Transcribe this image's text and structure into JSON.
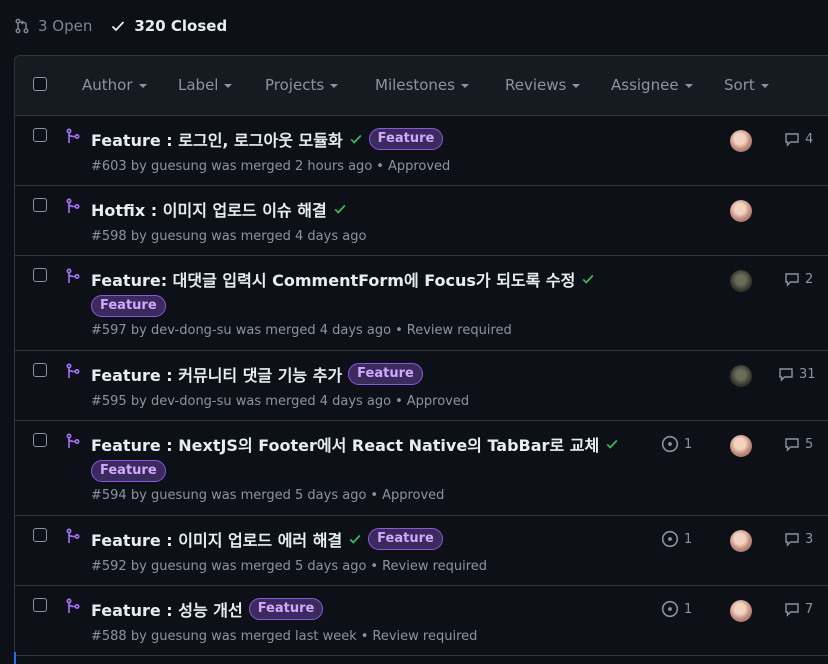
{
  "state": {
    "open_label": "3 Open",
    "closed_label": "320 Closed"
  },
  "filters": {
    "author": "Author",
    "label": "Label",
    "projects": "Projects",
    "milestones": "Milestones",
    "reviews": "Reviews",
    "assignee": "Assignee",
    "sort": "Sort"
  },
  "icons": {
    "pr_open": "git-pull-request-icon",
    "closed_check": "check-icon",
    "merged": "git-merge-icon",
    "status_success": "check-icon",
    "linked_issue": "issue-opened-icon",
    "comment": "comment-icon"
  },
  "colors": {
    "merged": "#a371f7",
    "success": "#3fb950",
    "label_text": "#d2a8ff"
  },
  "pull_requests": [
    {
      "title": "Feature : 로그인, 로그아웃 모듈화",
      "label": "Feature",
      "number": "#603",
      "by": "by",
      "author": "guesung",
      "merged_text": "was merged 2 hours ago",
      "review": "Approved",
      "issues": "",
      "comments": "4"
    },
    {
      "title": "Hotfix : 이미지 업로드 이슈 해결",
      "label": "",
      "number": "#598",
      "by": "by",
      "author": "guesung",
      "merged_text": "was merged 4 days ago",
      "review": "",
      "issues": "",
      "comments": ""
    },
    {
      "title": "Feature: 대댓글 입력시 CommentForm에 Focus가 되도록 수정",
      "label": "Feature",
      "number": "#597",
      "by": "by",
      "author": "dev-dong-su",
      "merged_text": "was merged 4 days ago",
      "review": "Review required",
      "issues": "",
      "comments": "2"
    },
    {
      "title": "Feature : 커뮤니티 댓글 기능 추가",
      "label": "Feature",
      "number": "#595",
      "by": "by",
      "author": "dev-dong-su",
      "merged_text": "was merged 4 days ago",
      "review": "Approved",
      "issues": "",
      "comments": "31"
    },
    {
      "title": "Feature : NextJS의 Footer에서 React Native의 TabBar로 교체",
      "label": "Feature",
      "number": "#594",
      "by": "by",
      "author": "guesung",
      "merged_text": "was merged 5 days ago",
      "review": "Approved",
      "issues": "1",
      "comments": "5"
    },
    {
      "title": "Feature : 이미지 업로드 에러 해결",
      "label": "Feature",
      "number": "#592",
      "by": "by",
      "author": "guesung",
      "merged_text": "was merged 5 days ago",
      "review": "Review required",
      "issues": "1",
      "comments": "3"
    },
    {
      "title": "Feature : 성능 개선",
      "label": "Feature",
      "number": "#588",
      "by": "by",
      "author": "guesung",
      "merged_text": "was merged last week",
      "review": "Review required",
      "issues": "1",
      "comments": "7"
    }
  ]
}
